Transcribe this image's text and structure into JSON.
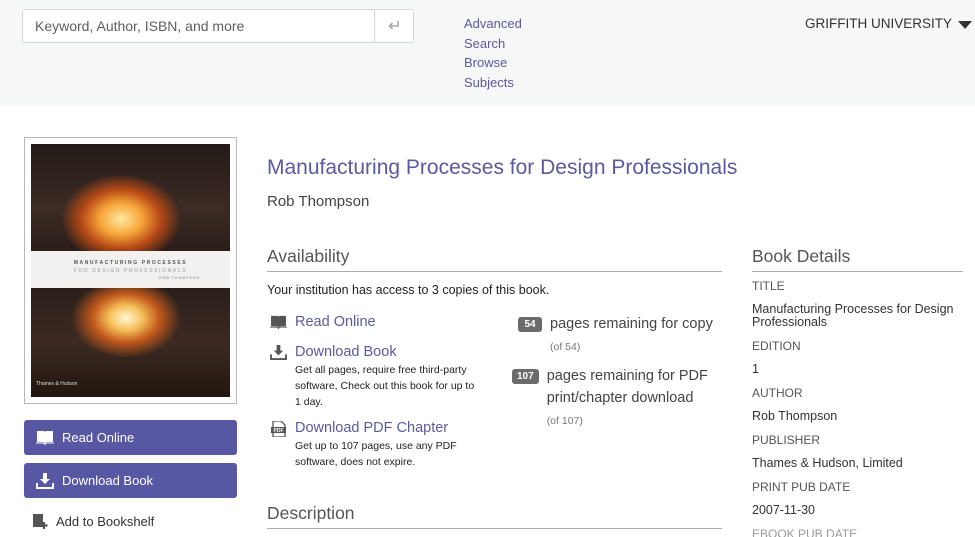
{
  "header": {
    "search": {
      "placeholder": "Keyword, Author, ISBN, and more",
      "value": "",
      "submit_icon": "enter-arrow-icon"
    },
    "nav": [
      "Advanced",
      "Search",
      "Browse",
      "Subjects"
    ],
    "institution": "GRIFFITH UNIVERSITY"
  },
  "cover": {
    "title_line1": "MANUFACTURING PROCESSES",
    "title_line2": "FOR DESIGN PROFESSIONALS",
    "author_line": "ROB THOMPSON",
    "publisher": "Thames & Hudson"
  },
  "actions": {
    "read_online": "Read Online",
    "download_book": "Download Book",
    "add_to_bookshelf": "Add to Bookshelf"
  },
  "book": {
    "title": "Manufacturing Processes for Design Professionals",
    "author": "Rob Thompson"
  },
  "availability": {
    "heading": "Availability",
    "note": "Your institution has access to 3 copies of this book.",
    "options": [
      {
        "label": "Read Online",
        "icon": "book-open-icon",
        "desc": ""
      },
      {
        "label": "Download Book",
        "icon": "download-icon",
        "desc": "Get all pages, require free third-party software, Check out this book for up to 1 day."
      },
      {
        "label": "Download PDF Chapter",
        "icon": "pdf-file-icon",
        "desc": "Get up to 107 pages, use any PDF software, does not expire."
      }
    ],
    "quotas": [
      {
        "count": "54",
        "text": "pages remaining for copy",
        "of": "(of 54)"
      },
      {
        "count": "107",
        "text": "pages remaining for PDF print/chapter download",
        "of": "(of 107)"
      }
    ]
  },
  "description": {
    "heading": "Description"
  },
  "details": {
    "heading": "Book Details",
    "fields": [
      {
        "label": "TITLE",
        "value": "Manufacturing Processes for Design Professionals"
      },
      {
        "label": "EDITION",
        "value": "1"
      },
      {
        "label": "AUTHOR",
        "value": "Rob Thompson"
      },
      {
        "label": "PUBLISHER",
        "value": "Thames & Hudson, Limited"
      },
      {
        "label": "PRINT PUB DATE",
        "value": "2007-11-30"
      },
      {
        "label": "EBOOK PUB DATE",
        "value": ""
      }
    ]
  },
  "colors": {
    "accent": "#5757a3",
    "link": "#5a5aa0",
    "badge": "#6b6b6b",
    "header_bg": "#f6f7f7"
  }
}
